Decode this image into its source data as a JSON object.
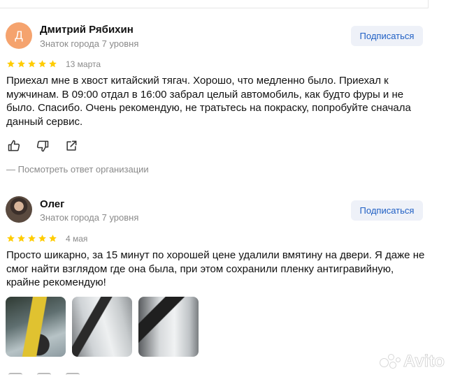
{
  "reviews": [
    {
      "avatar_letter": "Д",
      "name": "Дмитрий Рябихин",
      "rank": "Знаток города 7 уровня",
      "subscribe_label": "Подписаться",
      "rating": 5,
      "date": "13 марта",
      "text": "Приехал мне в хвост китайский тягач. Хорошо, что медленно было. Приехал к\nмужчинам. В 09:00 отдал в 16:00 забрал целый автомобиль, как будто фуры и не\nбыло. Спасибо. Очень рекомендую, не тратьтесь на покраску, попробуйте сначала\nданный сервис.",
      "actions": [
        "like-icon",
        "dislike-icon",
        "share-icon"
      ],
      "reply_link": "— Посмотреть ответ организации"
    },
    {
      "name": "Олег",
      "rank": "Знаток города 7 уровня",
      "subscribe_label": "Подписаться",
      "rating": 5,
      "date": "4 мая",
      "text": "Просто шикарно, за 15 минут по хорошей цене удалили вмятину на двери. Я даже не\nсмог найти взглядом где она была, при этом сохранили пленку антигравийную,\nкрайне рекомендую!",
      "photos": [
        "photo-1",
        "photo-2",
        "photo-3"
      ]
    }
  ],
  "watermark": "Avito",
  "colors": {
    "accent": "#1f5fc4",
    "star": "#ffcc00",
    "muted": "#8a8a8a",
    "avatar_bg": "#f5a36e"
  }
}
